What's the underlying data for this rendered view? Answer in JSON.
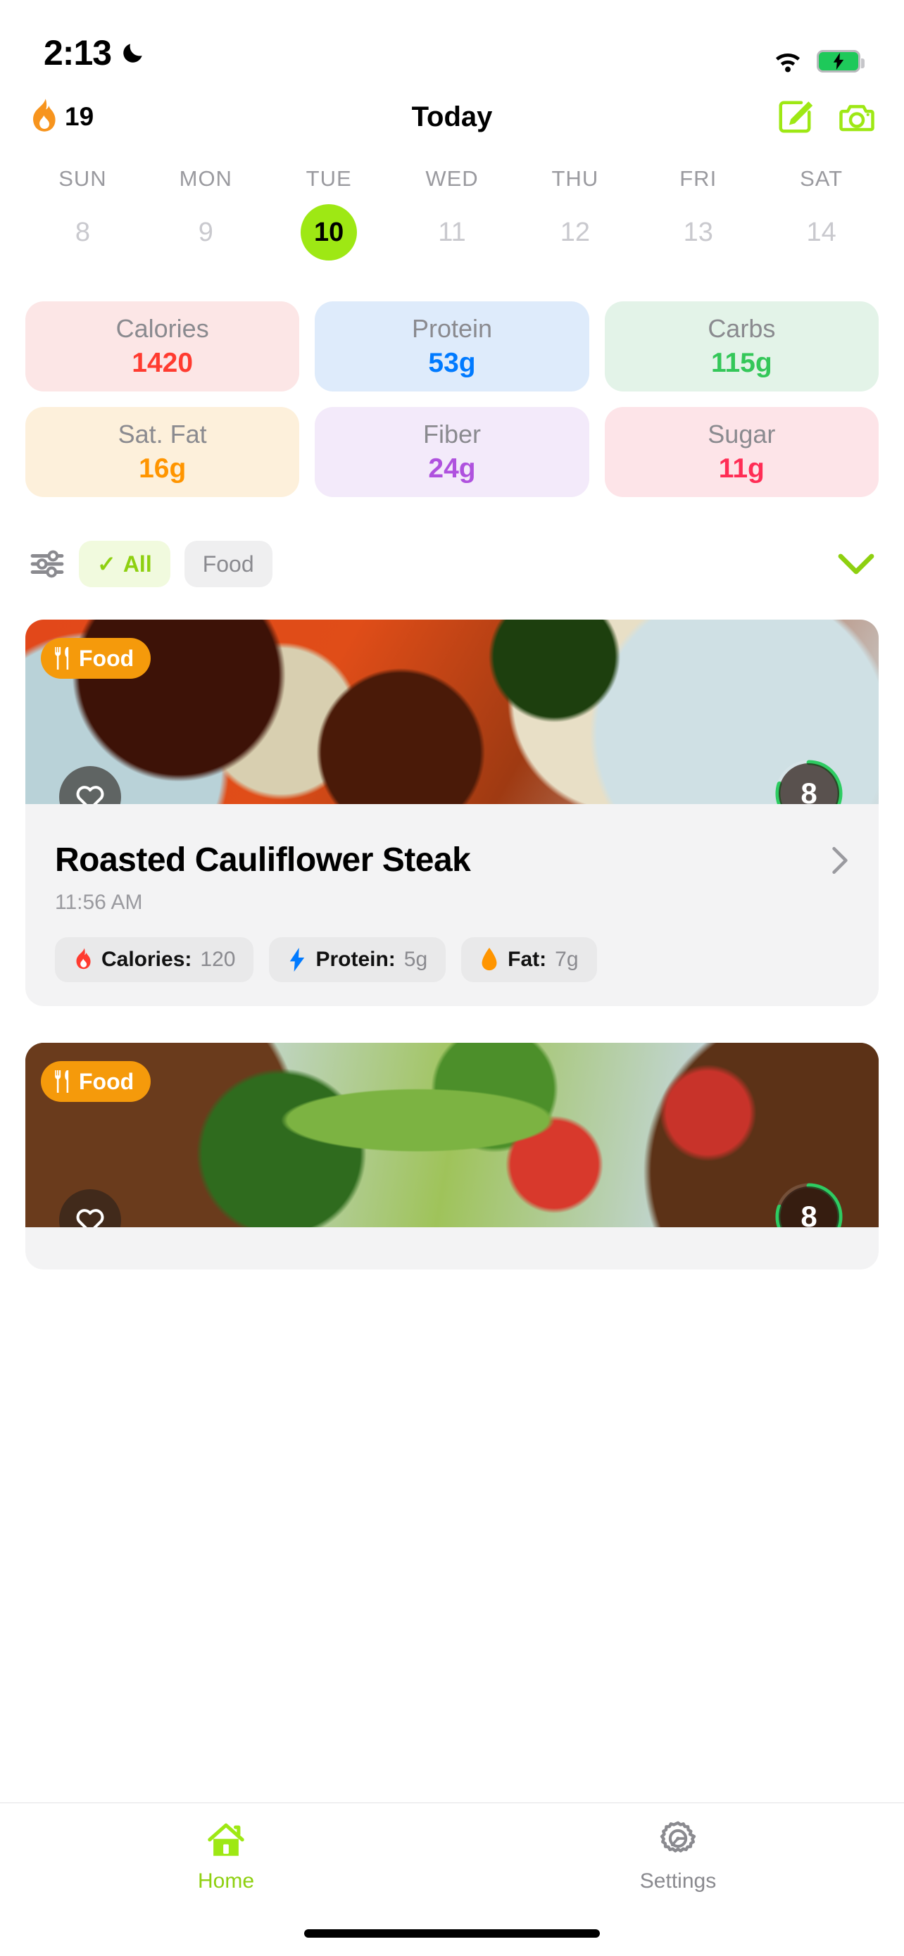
{
  "status_bar": {
    "time": "2:13",
    "dnd_icon": "moon-icon",
    "wifi_icon": "wifi-icon",
    "battery_icon": "battery-charging-icon"
  },
  "header": {
    "streak_icon": "flame-icon",
    "streak_count": "19",
    "title": "Today",
    "edit_icon": "edit-square-icon",
    "camera_icon": "camera-icon"
  },
  "week": {
    "days": [
      {
        "name": "SUN",
        "num": "8",
        "selected": false
      },
      {
        "name": "MON",
        "num": "9",
        "selected": false
      },
      {
        "name": "TUE",
        "num": "10",
        "selected": true
      },
      {
        "name": "WED",
        "num": "11",
        "selected": false
      },
      {
        "name": "THU",
        "num": "12",
        "selected": false
      },
      {
        "name": "FRI",
        "num": "13",
        "selected": false
      },
      {
        "name": "SAT",
        "num": "14",
        "selected": false
      }
    ],
    "selected_color": "#9EE814"
  },
  "macros": [
    {
      "label": "Calories",
      "value": "1420",
      "bg": "#FCE6E6",
      "color": "#FF3B30"
    },
    {
      "label": "Protein",
      "value": "53g",
      "bg": "#DEEBFB",
      "color": "#007AFF"
    },
    {
      "label": "Carbs",
      "value": "115g",
      "bg": "#E3F3E8",
      "color": "#34C759"
    },
    {
      "label": "Sat. Fat",
      "value": "16g",
      "bg": "#FDF0DB",
      "color": "#FF9500"
    },
    {
      "label": "Fiber",
      "value": "24g",
      "bg": "#F3EAFA",
      "color": "#AF52DE"
    },
    {
      "label": "Sugar",
      "value": "11g",
      "bg": "#FDE4E8",
      "color": "#FF2D55"
    }
  ],
  "filters": {
    "settings_icon": "sliders-icon",
    "chips": [
      {
        "label": "All",
        "active": true,
        "check": "✓"
      },
      {
        "label": "Food",
        "active": false,
        "check": ""
      }
    ],
    "expand_icon": "chevron-down-icon",
    "accent_color": "#8ED010"
  },
  "entries": [
    {
      "badge_label": "Food",
      "badge_icon": "cutlery-icon",
      "badge_color": "#F59A0B",
      "favorite_icon": "heart-icon",
      "score": "8",
      "score_ring_color": "#2ECC62",
      "score_max": "10",
      "title": "Roasted Cauliflower Steak",
      "time": "11:56 AM",
      "chevron_icon": "chevron-right-icon",
      "nutrients": [
        {
          "icon": "flame-icon",
          "label": "Calories:",
          "value": "120",
          "color": "#FF3B30"
        },
        {
          "icon": "bolt-icon",
          "label": "Protein:",
          "value": "5g",
          "color": "#007AFF"
        },
        {
          "icon": "droplet-icon",
          "label": "Fat:",
          "value": "7g",
          "color": "#FF9500"
        }
      ]
    },
    {
      "badge_label": "Food",
      "badge_icon": "cutlery-icon",
      "badge_color": "#F59A0B",
      "favorite_icon": "heart-icon",
      "score": "8",
      "score_ring_color": "#2ECC62",
      "score_max": "10"
    }
  ],
  "tabbar": {
    "tabs": [
      {
        "label": "Home",
        "icon": "home-icon",
        "active": true
      },
      {
        "label": "Settings",
        "icon": "gear-icon",
        "active": false
      }
    ],
    "active_color": "#8ED010",
    "inactive_color": "#8A8A8F"
  }
}
